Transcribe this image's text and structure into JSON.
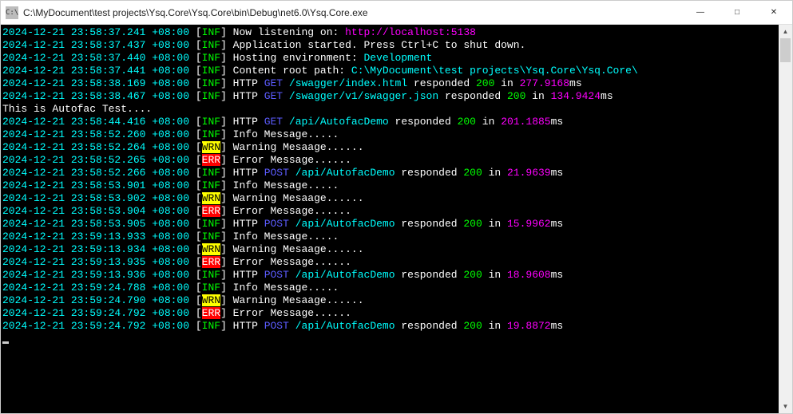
{
  "window": {
    "icon_label": "C:\\",
    "title": "C:\\MyDocument\\test projects\\Ysq.Core\\Ysq.Core\\bin\\Debug\\net6.0\\Ysq.Core.exe"
  },
  "lines": [
    {
      "ts": "2024-12-21 23:58:37.241 +08:00",
      "lv": "INF",
      "segs": [
        {
          "c": "txt",
          "t": "Now listening on: "
        },
        {
          "c": "mag",
          "t": "http://localhost:5138"
        }
      ]
    },
    {
      "ts": "2024-12-21 23:58:37.437 +08:00",
      "lv": "INF",
      "segs": [
        {
          "c": "txt",
          "t": "Application started. Press Ctrl+C to shut down."
        }
      ]
    },
    {
      "ts": "2024-12-21 23:58:37.440 +08:00",
      "lv": "INF",
      "segs": [
        {
          "c": "txt",
          "t": "Hosting environment: "
        },
        {
          "c": "cyan",
          "t": "Development"
        }
      ]
    },
    {
      "ts": "2024-12-21 23:58:37.441 +08:00",
      "lv": "INF",
      "segs": [
        {
          "c": "txt",
          "t": "Content root path: "
        },
        {
          "c": "cyan",
          "t": "C:\\MyDocument\\test projects\\Ysq.Core\\Ysq.Core\\"
        }
      ]
    },
    {
      "ts": "2024-12-21 23:58:38.169 +08:00",
      "lv": "INF",
      "segs": [
        {
          "c": "txt",
          "t": "HTTP "
        },
        {
          "c": "blue",
          "t": "GET"
        },
        {
          "c": "txt",
          "t": " "
        },
        {
          "c": "cyan",
          "t": "/swagger/index.html"
        },
        {
          "c": "txt",
          "t": " responded "
        },
        {
          "c": "green",
          "t": "200"
        },
        {
          "c": "txt",
          "t": " in "
        },
        {
          "c": "mag",
          "t": "277.9168"
        },
        {
          "c": "txt",
          "t": "ms"
        }
      ]
    },
    {
      "ts": "2024-12-21 23:58:38.467 +08:00",
      "lv": "INF",
      "segs": [
        {
          "c": "txt",
          "t": "HTTP "
        },
        {
          "c": "blue",
          "t": "GET"
        },
        {
          "c": "txt",
          "t": " "
        },
        {
          "c": "cyan",
          "t": "/swagger/v1/swagger.json"
        },
        {
          "c": "txt",
          "t": " responded "
        },
        {
          "c": "green",
          "t": "200"
        },
        {
          "c": "txt",
          "t": " in "
        },
        {
          "c": "mag",
          "t": "134.9424"
        },
        {
          "c": "txt",
          "t": "ms"
        }
      ]
    },
    {
      "plain": "This is Autofac Test...."
    },
    {
      "ts": "2024-12-21 23:58:44.416 +08:00",
      "lv": "INF",
      "segs": [
        {
          "c": "txt",
          "t": "HTTP "
        },
        {
          "c": "blue",
          "t": "GET"
        },
        {
          "c": "txt",
          "t": " "
        },
        {
          "c": "cyan",
          "t": "/api/AutofacDemo"
        },
        {
          "c": "txt",
          "t": " responded "
        },
        {
          "c": "green",
          "t": "200"
        },
        {
          "c": "txt",
          "t": " in "
        },
        {
          "c": "mag",
          "t": "201.1885"
        },
        {
          "c": "txt",
          "t": "ms"
        }
      ]
    },
    {
      "ts": "2024-12-21 23:58:52.260 +08:00",
      "lv": "INF",
      "segs": [
        {
          "c": "txt",
          "t": "Info Message....."
        }
      ]
    },
    {
      "ts": "2024-12-21 23:58:52.264 +08:00",
      "lv": "WRN",
      "segs": [
        {
          "c": "txt",
          "t": "Warning Mesaage......"
        }
      ]
    },
    {
      "ts": "2024-12-21 23:58:52.265 +08:00",
      "lv": "ERR",
      "segs": [
        {
          "c": "txt",
          "t": "Error Message......"
        }
      ]
    },
    {
      "ts": "2024-12-21 23:58:52.266 +08:00",
      "lv": "INF",
      "segs": [
        {
          "c": "txt",
          "t": "HTTP "
        },
        {
          "c": "blue",
          "t": "POST"
        },
        {
          "c": "txt",
          "t": " "
        },
        {
          "c": "cyan",
          "t": "/api/AutofacDemo"
        },
        {
          "c": "txt",
          "t": " responded "
        },
        {
          "c": "green",
          "t": "200"
        },
        {
          "c": "txt",
          "t": " in "
        },
        {
          "c": "mag",
          "t": "21.9639"
        },
        {
          "c": "txt",
          "t": "ms"
        }
      ]
    },
    {
      "ts": "2024-12-21 23:58:53.901 +08:00",
      "lv": "INF",
      "segs": [
        {
          "c": "txt",
          "t": "Info Message....."
        }
      ]
    },
    {
      "ts": "2024-12-21 23:58:53.902 +08:00",
      "lv": "WRN",
      "segs": [
        {
          "c": "txt",
          "t": "Warning Mesaage......"
        }
      ]
    },
    {
      "ts": "2024-12-21 23:58:53.904 +08:00",
      "lv": "ERR",
      "segs": [
        {
          "c": "txt",
          "t": "Error Message......"
        }
      ]
    },
    {
      "ts": "2024-12-21 23:58:53.905 +08:00",
      "lv": "INF",
      "segs": [
        {
          "c": "txt",
          "t": "HTTP "
        },
        {
          "c": "blue",
          "t": "POST"
        },
        {
          "c": "txt",
          "t": " "
        },
        {
          "c": "cyan",
          "t": "/api/AutofacDemo"
        },
        {
          "c": "txt",
          "t": " responded "
        },
        {
          "c": "green",
          "t": "200"
        },
        {
          "c": "txt",
          "t": " in "
        },
        {
          "c": "mag",
          "t": "15.9962"
        },
        {
          "c": "txt",
          "t": "ms"
        }
      ]
    },
    {
      "ts": "2024-12-21 23:59:13.933 +08:00",
      "lv": "INF",
      "segs": [
        {
          "c": "txt",
          "t": "Info Message....."
        }
      ]
    },
    {
      "ts": "2024-12-21 23:59:13.934 +08:00",
      "lv": "WRN",
      "segs": [
        {
          "c": "txt",
          "t": "Warning Mesaage......"
        }
      ]
    },
    {
      "ts": "2024-12-21 23:59:13.935 +08:00",
      "lv": "ERR",
      "segs": [
        {
          "c": "txt",
          "t": "Error Message......"
        }
      ]
    },
    {
      "ts": "2024-12-21 23:59:13.936 +08:00",
      "lv": "INF",
      "segs": [
        {
          "c": "txt",
          "t": "HTTP "
        },
        {
          "c": "blue",
          "t": "POST"
        },
        {
          "c": "txt",
          "t": " "
        },
        {
          "c": "cyan",
          "t": "/api/AutofacDemo"
        },
        {
          "c": "txt",
          "t": " responded "
        },
        {
          "c": "green",
          "t": "200"
        },
        {
          "c": "txt",
          "t": " in "
        },
        {
          "c": "mag",
          "t": "18.9608"
        },
        {
          "c": "txt",
          "t": "ms"
        }
      ]
    },
    {
      "ts": "2024-12-21 23:59:24.788 +08:00",
      "lv": "INF",
      "segs": [
        {
          "c": "txt",
          "t": "Info Message....."
        }
      ]
    },
    {
      "ts": "2024-12-21 23:59:24.790 +08:00",
      "lv": "WRN",
      "segs": [
        {
          "c": "txt",
          "t": "Warning Mesaage......"
        }
      ]
    },
    {
      "ts": "2024-12-21 23:59:24.792 +08:00",
      "lv": "ERR",
      "segs": [
        {
          "c": "txt",
          "t": "Error Message......"
        }
      ]
    },
    {
      "ts": "2024-12-21 23:59:24.792 +08:00",
      "lv": "INF",
      "segs": [
        {
          "c": "txt",
          "t": "HTTP "
        },
        {
          "c": "blue",
          "t": "POST"
        },
        {
          "c": "txt",
          "t": " "
        },
        {
          "c": "cyan",
          "t": "/api/AutofacDemo"
        },
        {
          "c": "txt",
          "t": " responded "
        },
        {
          "c": "green",
          "t": "200"
        },
        {
          "c": "txt",
          "t": " in "
        },
        {
          "c": "mag",
          "t": "19.8872"
        },
        {
          "c": "txt",
          "t": "ms"
        }
      ]
    }
  ]
}
